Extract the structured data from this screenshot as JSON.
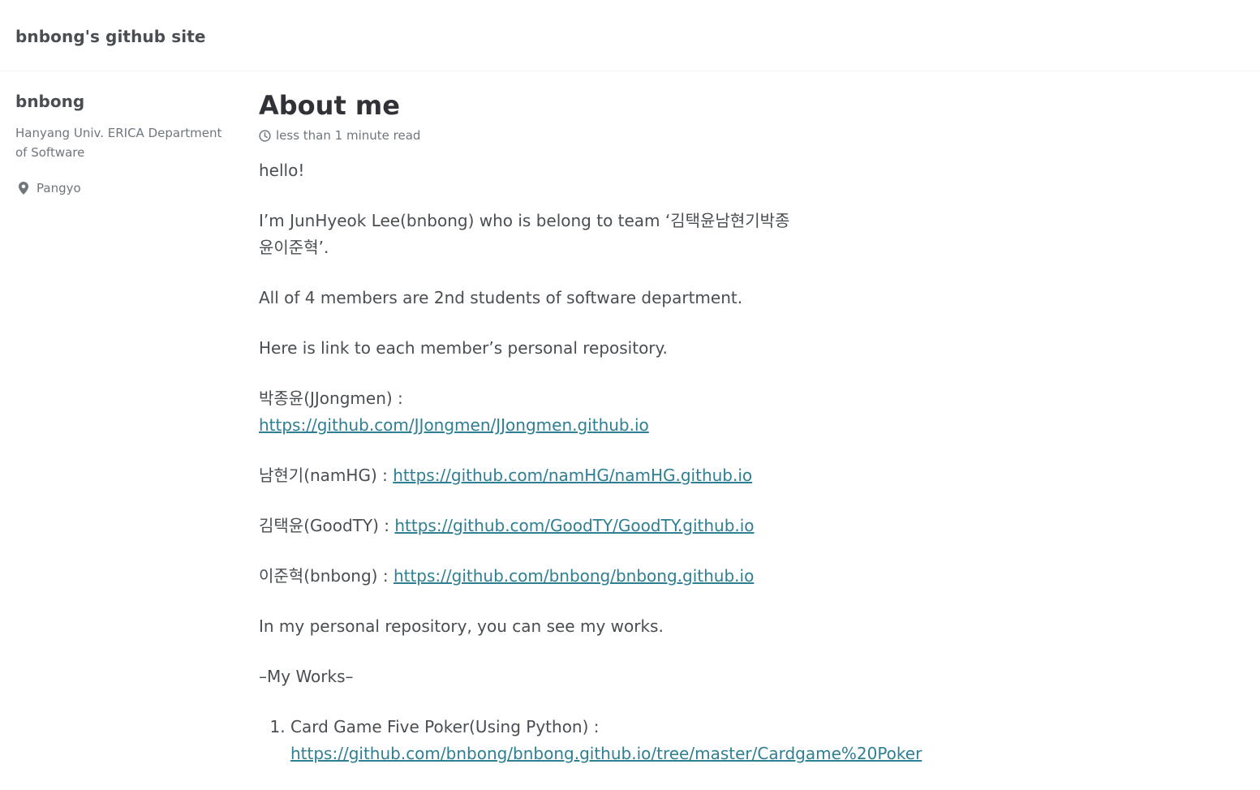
{
  "header": {
    "site_title": "bnbong's github site"
  },
  "sidebar": {
    "author_name": "bnbong",
    "bio": "Hanyang Univ. ERICA Department of Software",
    "location": "Pangyo",
    "location_icon": "map-pin-icon"
  },
  "main": {
    "title": "About me",
    "read_time": "less than 1 minute read",
    "read_time_icon": "clock-icon",
    "p1": "hello!",
    "p2": "I’m JunHyeok Lee(bnbong) who is belong to team ‘김택윤남현기박종윤이준혁’.",
    "p3": "All of 4 members are 2nd students of software department.",
    "p4": "Here is link to each member’s personal repository.",
    "members": [
      {
        "label": "박종윤(JJongmen) : ",
        "url": "https://github.com/JJongmen/JJongmen.github.io"
      },
      {
        "label": "남현기(namHG) : ",
        "url": "https://github.com/namHG/namHG.github.io"
      },
      {
        "label": "김택윤(GoodTY) : ",
        "url": "https://github.com/GoodTY/GoodTY.github.io"
      },
      {
        "label": "이준혁(bnbong) : ",
        "url": "https://github.com/bnbong/bnbong.github.io"
      }
    ],
    "p5": "In my personal repository, you can see my works.",
    "p6": "–My Works–",
    "works": [
      {
        "label": "Card Game Five Poker(Using Python) : ",
        "url": "https://github.com/bnbong/bnbong.github.io/tree/master/Cardgame%20Poker"
      }
    ]
  },
  "colors": {
    "link": "#2f7f93",
    "text": "#494e52",
    "muted": "#6f777d"
  }
}
